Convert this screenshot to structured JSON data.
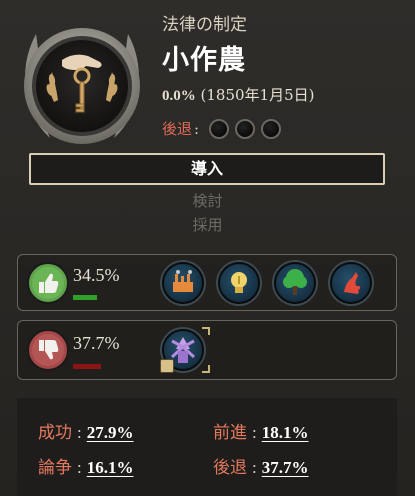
{
  "header": {
    "title": "法律の制定",
    "law_name": "小作農",
    "progress_percent": "0.0%",
    "progress_date": "(1850年1月5日)"
  },
  "setback": {
    "label": "後退",
    "colon": ":",
    "filled": 0,
    "total": 3
  },
  "stages": {
    "enact": "導入",
    "debate": "検討",
    "adopt": "採用"
  },
  "support": {
    "percent": "34.5%",
    "bar_color": "#2fa12b",
    "icon": "thumbs-up-icon",
    "groups": [
      {
        "icon": "industrialists-icon"
      },
      {
        "icon": "intelligentsia-icon"
      },
      {
        "icon": "rural-folk-icon"
      },
      {
        "icon": "trade-unions-icon"
      }
    ]
  },
  "oppose": {
    "percent": "37.7%",
    "bar_color": "#8a1515",
    "icon": "thumbs-down-icon",
    "groups": [
      {
        "icon": "landowners-icon"
      }
    ]
  },
  "stats": {
    "success_label": "成功",
    "success_value": "27.9%",
    "advance_label": "前進",
    "advance_value": "18.1%",
    "debate_label": "論争",
    "debate_value": "16.1%",
    "setback_label": "後退",
    "setback_value": "37.7%",
    "colon": ":"
  },
  "colors": {
    "accent_red": "#e2785e",
    "panel": "#2a2825"
  }
}
